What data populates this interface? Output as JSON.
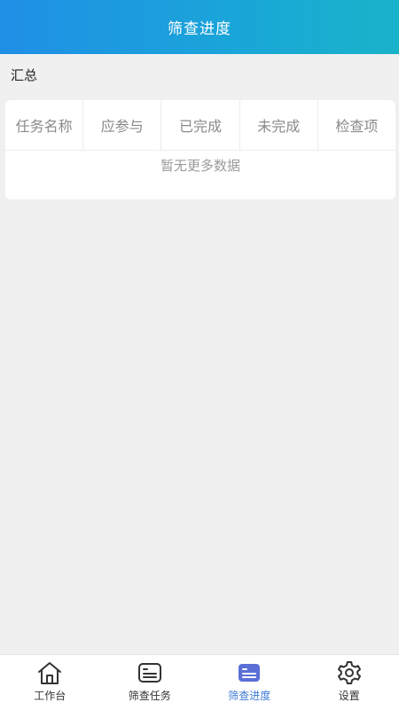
{
  "header": {
    "title": "筛查进度"
  },
  "summary": {
    "label": "汇总"
  },
  "table": {
    "columns": [
      "任务名称",
      "应参与",
      "已完成",
      "未完成",
      "检查项"
    ],
    "empty_text": "暂无更多数据"
  },
  "tabbar": {
    "items": [
      {
        "label": "工作台",
        "icon": "home-icon",
        "active": false
      },
      {
        "label": "筛查任务",
        "icon": "task-list-icon",
        "active": false
      },
      {
        "label": "筛查进度",
        "icon": "progress-icon",
        "active": true
      },
      {
        "label": "设置",
        "icon": "gear-icon",
        "active": false
      }
    ]
  },
  "colors": {
    "header_start": "#1f8fe6",
    "header_end": "#19b3c9",
    "active_tab": "#3e7bd6",
    "active_icon": "#5b6fd6",
    "inactive": "#333333"
  }
}
